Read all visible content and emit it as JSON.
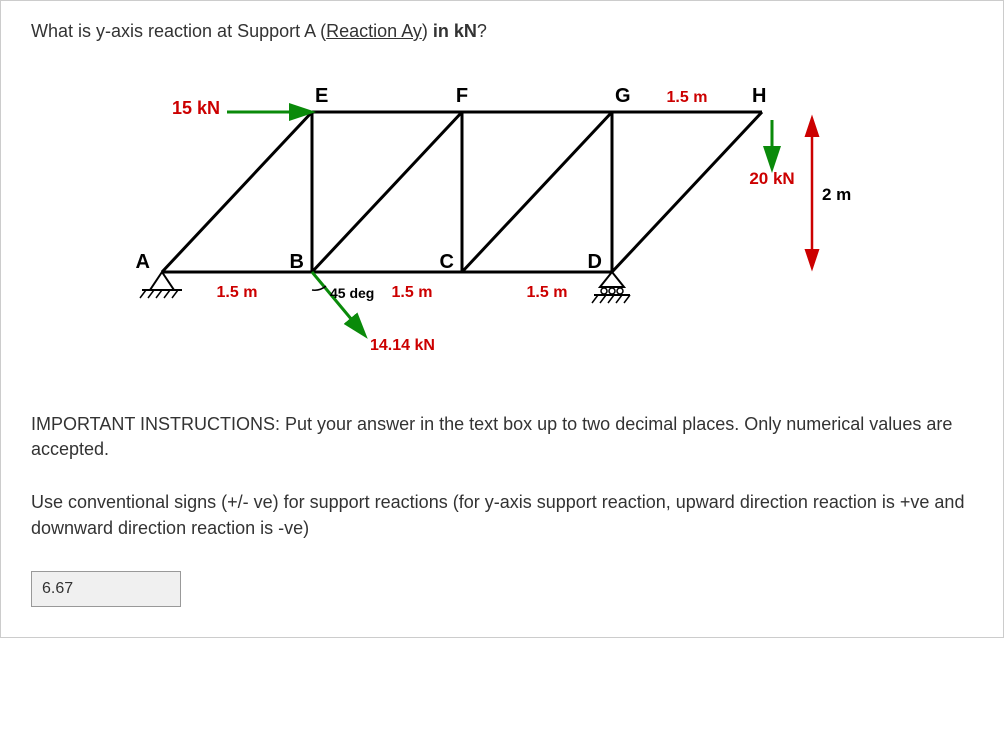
{
  "question": {
    "prefix": "What is y-axis reaction at Support A (",
    "emphasis": "Reaction Ay",
    "suffix_bold": " in kN",
    "qmark": "?"
  },
  "figure": {
    "nodes": {
      "A": "A",
      "B": "B",
      "C": "C",
      "D": "D",
      "E": "E",
      "F": "F",
      "G": "G",
      "H": "H"
    },
    "dims": {
      "AB": "1.5 m",
      "BC": "1.5 m",
      "CD": "1.5 m",
      "GH": "1.5 m",
      "height": "2 m"
    },
    "loads": {
      "leftForce": "15 kN",
      "angledForce": "14.14 kN",
      "angle": "45 deg",
      "rightForce": "20 kN"
    }
  },
  "instructions": {
    "p1": "IMPORTANT INSTRUCTIONS: Put your answer in the text box up to two decimal places. Only numerical values are accepted.",
    "p2": "Use conventional signs (+/- ve) for support reactions (for y-axis support reaction, upward direction reaction is +ve and downward direction reaction is -ve)"
  },
  "answer": "6.67"
}
